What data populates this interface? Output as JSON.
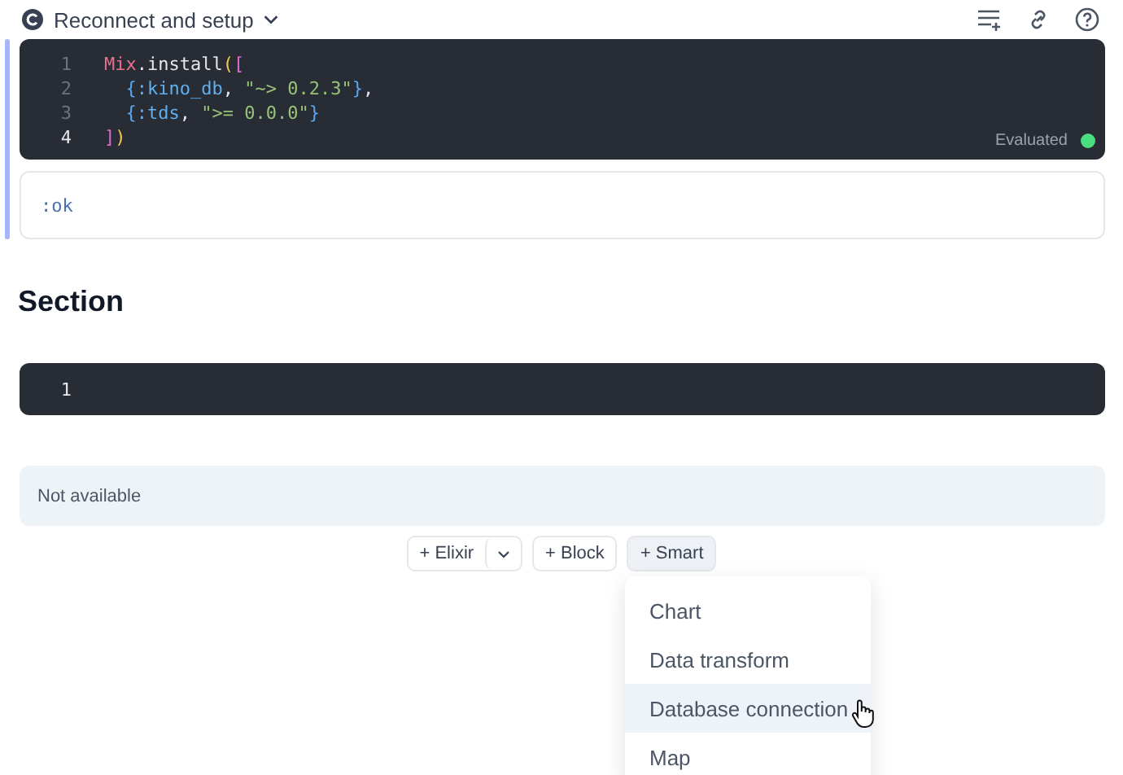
{
  "header": {
    "title": "Reconnect and setup"
  },
  "setup_cell": {
    "lines": [
      {
        "number": "1",
        "current": false,
        "tokens": [
          {
            "text": "Mix",
            "kind": "module"
          },
          {
            "text": ".install",
            "kind": "plain"
          },
          {
            "text": "(",
            "kind": "paren"
          },
          {
            "text": "[",
            "kind": "bracket"
          }
        ]
      },
      {
        "number": "2",
        "current": false,
        "tokens": [
          {
            "text": "  {",
            "kind": "brace"
          },
          {
            "text": ":kino_db",
            "kind": "atom"
          },
          {
            "text": ", ",
            "kind": "plain"
          },
          {
            "text": "\"~> 0.2.3\"",
            "kind": "string"
          },
          {
            "text": "}",
            "kind": "brace"
          },
          {
            "text": ",",
            "kind": "plain"
          }
        ]
      },
      {
        "number": "3",
        "current": false,
        "tokens": [
          {
            "text": "  {",
            "kind": "brace"
          },
          {
            "text": ":tds",
            "kind": "atom"
          },
          {
            "text": ", ",
            "kind": "plain"
          },
          {
            "text": "\">= 0.0.0\"",
            "kind": "string"
          },
          {
            "text": "}",
            "kind": "brace"
          }
        ]
      },
      {
        "number": "4",
        "current": true,
        "tokens": [
          {
            "text": "]",
            "kind": "bracket"
          },
          {
            "text": ")",
            "kind": "paren"
          }
        ]
      }
    ],
    "status": "Evaluated",
    "status_dot": {
      "color": "#4ade80"
    },
    "output": ":ok"
  },
  "section": {
    "title": "Section"
  },
  "code_cell": {
    "lines": [
      {
        "number": "1"
      }
    ]
  },
  "notice": "Not available",
  "insert_buttons": [
    {
      "label": "+ Elixir",
      "kind": "split"
    },
    {
      "label": "+ Block",
      "kind": "plain"
    },
    {
      "label": "+ Smart",
      "kind": "open"
    }
  ],
  "smart_menu": [
    {
      "label": "Chart",
      "selected": false
    },
    {
      "label": "Data transform",
      "selected": false
    },
    {
      "label": "Database connection",
      "selected": true
    },
    {
      "label": "Map",
      "selected": false
    }
  ]
}
